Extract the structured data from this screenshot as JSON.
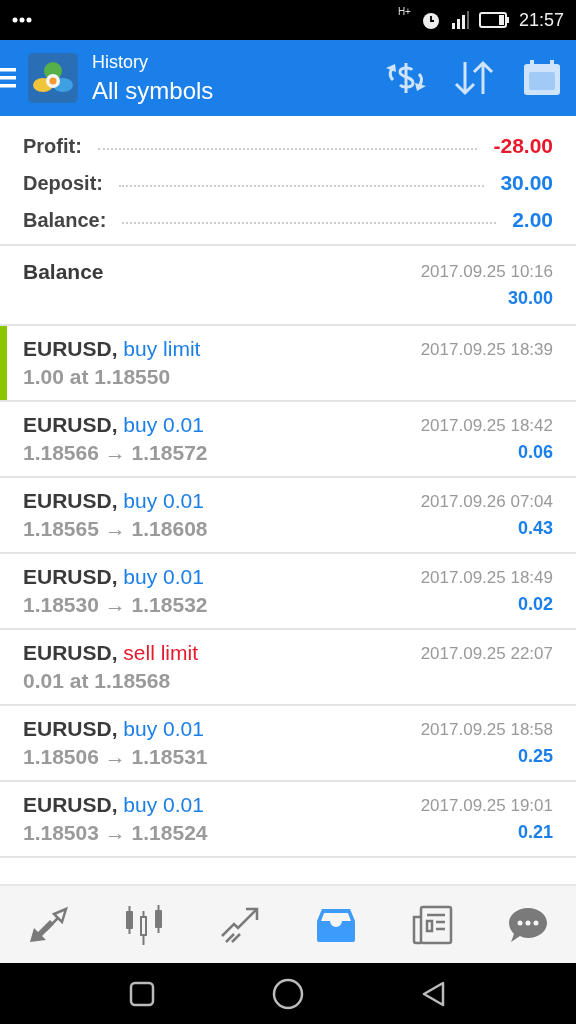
{
  "status_bar": {
    "network": "H+",
    "time": "21:57"
  },
  "header": {
    "subtitle": "History",
    "title": "All symbols"
  },
  "summary": [
    {
      "label": "Profit:",
      "value": "-28.00",
      "kind": "loss"
    },
    {
      "label": "Deposit:",
      "value": "30.00",
      "kind": "gain"
    },
    {
      "label": "Balance:",
      "value": "2.00",
      "kind": "gain"
    }
  ],
  "balance_entry": {
    "label": "Balance",
    "time": "2017.09.25 10:16",
    "amount": "30.00"
  },
  "trades": [
    {
      "symbol": "EURUSD,",
      "action": "buy limit",
      "kind": "buy",
      "detail": "1.00 at 1.18550",
      "time": "2017.09.25 18:39",
      "selected": true
    },
    {
      "symbol": "EURUSD,",
      "action": "buy 0.01",
      "kind": "buy",
      "detail": "1.18566 → 1.18572",
      "time": "2017.09.25 18:42",
      "profit": "0.06",
      "selected": false
    },
    {
      "symbol": "EURUSD,",
      "action": "buy 0.01",
      "kind": "buy",
      "detail": "1.18565 → 1.18608",
      "time": "2017.09.26 07:04",
      "profit": "0.43",
      "selected": false
    },
    {
      "symbol": "EURUSD,",
      "action": "buy 0.01",
      "kind": "buy",
      "detail": "1.18530 → 1.18532",
      "time": "2017.09.25 18:49",
      "profit": "0.02",
      "selected": false
    },
    {
      "symbol": "EURUSD,",
      "action": "sell limit",
      "kind": "sell",
      "detail": "0.01 at 1.18568",
      "time": "2017.09.25 22:07",
      "selected": false
    },
    {
      "symbol": "EURUSD,",
      "action": "buy 0.01",
      "kind": "buy",
      "detail": "1.18506 → 1.18531",
      "time": "2017.09.25 18:58",
      "profit": "0.25",
      "selected": false
    },
    {
      "symbol": "EURUSD,",
      "action": "buy 0.01",
      "kind": "buy",
      "detail": "1.18503 → 1.18524",
      "time": "2017.09.25 19:01",
      "profit": "0.21",
      "selected": false
    }
  ],
  "bottom_nav": [
    {
      "kind": "quotes",
      "selected": false
    },
    {
      "kind": "chart",
      "selected": false
    },
    {
      "kind": "trade",
      "selected": false
    },
    {
      "kind": "history",
      "selected": true
    },
    {
      "kind": "news",
      "selected": false
    },
    {
      "kind": "chat",
      "selected": false
    }
  ]
}
